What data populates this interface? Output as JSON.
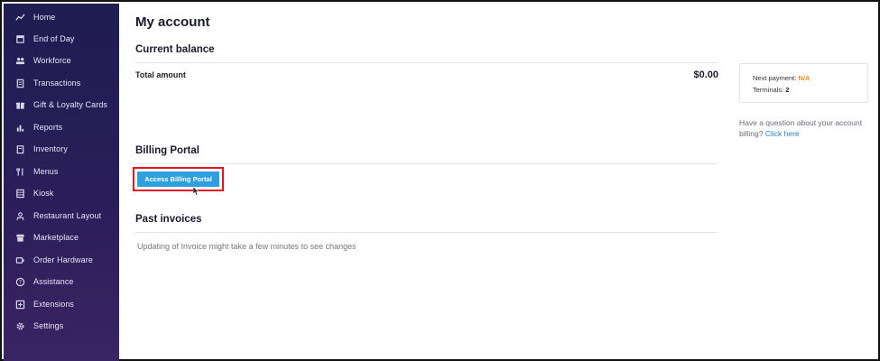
{
  "sidebar": {
    "items": [
      {
        "label": "Home",
        "icon": "trend-icon"
      },
      {
        "label": "End of Day",
        "icon": "calendar-icon"
      },
      {
        "label": "Workforce",
        "icon": "people-icon"
      },
      {
        "label": "Transactions",
        "icon": "receipt-icon"
      },
      {
        "label": "Gift & Loyalty Cards",
        "icon": "gift-icon"
      },
      {
        "label": "Reports",
        "icon": "bar-chart-icon"
      },
      {
        "label": "Inventory",
        "icon": "clipboard-icon"
      },
      {
        "label": "Menus",
        "icon": "fork-knife-icon"
      },
      {
        "label": "Kiosk",
        "icon": "kiosk-icon"
      },
      {
        "label": "Restaurant Layout",
        "icon": "layout-icon"
      },
      {
        "label": "Marketplace",
        "icon": "store-icon"
      },
      {
        "label": "Order Hardware",
        "icon": "hardware-icon"
      },
      {
        "label": "Assistance",
        "icon": "help-circle-icon"
      },
      {
        "label": "Extensions",
        "icon": "plus-square-icon"
      },
      {
        "label": "Settings",
        "icon": "gear-icon"
      }
    ]
  },
  "main": {
    "title": "My account",
    "current_balance": {
      "heading": "Current balance",
      "total_label": "Total amount",
      "total_value": "$0.00"
    },
    "billing_portal": {
      "heading": "Billing Portal",
      "button_label": "Access Billing Portal"
    },
    "past_invoices": {
      "heading": "Past invoices",
      "note": "Updating of Invoice might take a few minutes to see changes"
    }
  },
  "side_panel": {
    "next_payment_label": "Next payment:",
    "next_payment_value": "N/A",
    "terminals_label": "Terminals:",
    "terminals_value": "2",
    "help_text": "Have a question about your account billing?",
    "help_link": "Click here"
  },
  "colors": {
    "sidebar_bg": "#221e55",
    "button_bg": "#2ea0dd",
    "highlight_border": "#e3141b",
    "na_orange": "#f08a1c",
    "link_blue": "#2a7fc6"
  }
}
